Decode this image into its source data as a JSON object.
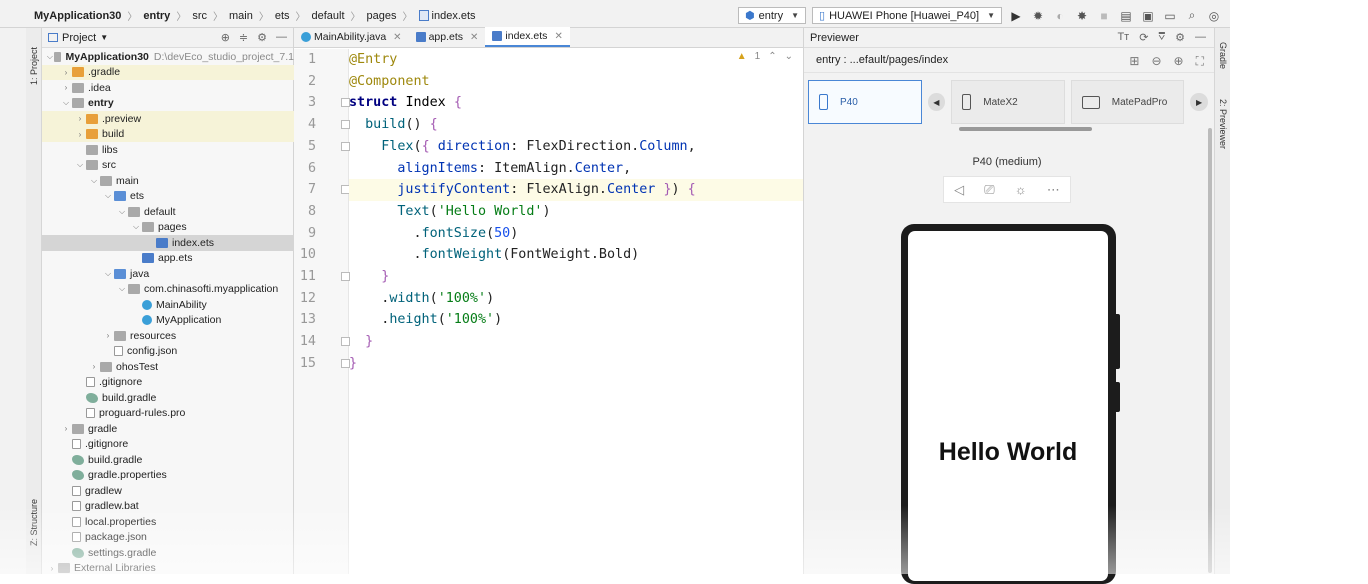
{
  "breadcrumb": [
    "MyApplication30",
    "entry",
    "src",
    "main",
    "ets",
    "default",
    "pages",
    "index.ets"
  ],
  "toolbar": {
    "run_config": "entry",
    "device": "HUAWEI Phone [Huawei_P40]"
  },
  "left_stripe": {
    "project_tab": "1: Project",
    "structure_tab": "Z: Structure"
  },
  "project_panel": {
    "title": "Project",
    "tree": [
      {
        "label": "MyApplication30",
        "sub": "D:\\devEco_studio_project_7.1",
        "depth": 0,
        "icon": "folder",
        "arrow": "open",
        "bold": true
      },
      {
        "label": ".gradle",
        "depth": 1,
        "icon": "folder-o",
        "arrow": "closed",
        "hl": true
      },
      {
        "label": ".idea",
        "depth": 1,
        "icon": "folder",
        "arrow": "closed"
      },
      {
        "label": "entry",
        "depth": 1,
        "icon": "folder",
        "arrow": "open",
        "bold": true
      },
      {
        "label": ".preview",
        "depth": 2,
        "icon": "folder-o",
        "arrow": "closed",
        "hl": true
      },
      {
        "label": "build",
        "depth": 2,
        "icon": "folder-o",
        "arrow": "closed",
        "hl": true
      },
      {
        "label": "libs",
        "depth": 2,
        "icon": "folder",
        "arrow": ""
      },
      {
        "label": "src",
        "depth": 2,
        "icon": "folder",
        "arrow": "open"
      },
      {
        "label": "main",
        "depth": 3,
        "icon": "folder",
        "arrow": "open"
      },
      {
        "label": "ets",
        "depth": 4,
        "icon": "folder-b",
        "arrow": "open"
      },
      {
        "label": "default",
        "depth": 5,
        "icon": "folder",
        "arrow": "open"
      },
      {
        "label": "pages",
        "depth": 6,
        "icon": "folder",
        "arrow": "open"
      },
      {
        "label": "index.ets",
        "depth": 7,
        "icon": "ets",
        "arrow": "",
        "sel": true
      },
      {
        "label": "app.ets",
        "depth": 6,
        "icon": "ets",
        "arrow": ""
      },
      {
        "label": "java",
        "depth": 4,
        "icon": "folder-b",
        "arrow": "open"
      },
      {
        "label": "com.chinasofti.myapplication",
        "depth": 5,
        "icon": "folder",
        "arrow": "open"
      },
      {
        "label": "MainAbility",
        "depth": 6,
        "icon": "class",
        "arrow": ""
      },
      {
        "label": "MyApplication",
        "depth": 6,
        "icon": "class",
        "arrow": ""
      },
      {
        "label": "resources",
        "depth": 4,
        "icon": "folder",
        "arrow": "closed"
      },
      {
        "label": "config.json",
        "depth": 4,
        "icon": "file",
        "arrow": ""
      },
      {
        "label": "ohosTest",
        "depth": 3,
        "icon": "folder",
        "arrow": "closed"
      },
      {
        "label": ".gitignore",
        "depth": 2,
        "icon": "file",
        "arrow": ""
      },
      {
        "label": "build.gradle",
        "depth": 2,
        "icon": "gradle",
        "arrow": ""
      },
      {
        "label": "proguard-rules.pro",
        "depth": 2,
        "icon": "file",
        "arrow": ""
      },
      {
        "label": "gradle",
        "depth": 1,
        "icon": "folder",
        "arrow": "closed"
      },
      {
        "label": ".gitignore",
        "depth": 1,
        "icon": "file",
        "arrow": ""
      },
      {
        "label": "build.gradle",
        "depth": 1,
        "icon": "gradle",
        "arrow": ""
      },
      {
        "label": "gradle.properties",
        "depth": 1,
        "icon": "gradle",
        "arrow": ""
      },
      {
        "label": "gradlew",
        "depth": 1,
        "icon": "file",
        "arrow": ""
      },
      {
        "label": "gradlew.bat",
        "depth": 1,
        "icon": "file",
        "arrow": ""
      },
      {
        "label": "local.properties",
        "depth": 1,
        "icon": "file",
        "arrow": ""
      },
      {
        "label": "package.json",
        "depth": 1,
        "icon": "file",
        "arrow": ""
      },
      {
        "label": "settings.gradle",
        "depth": 1,
        "icon": "gradle",
        "arrow": ""
      },
      {
        "label": "External Libraries",
        "depth": 0,
        "icon": "folder",
        "arrow": "closed"
      }
    ]
  },
  "editor": {
    "tabs": [
      {
        "label": "MainAbility.java",
        "icon": "class",
        "active": false
      },
      {
        "label": "app.ets",
        "icon": "ets",
        "active": false
      },
      {
        "label": "index.ets",
        "icon": "ets",
        "active": true
      }
    ],
    "warning_count": "1",
    "lines": [
      [
        [
          "an",
          "@Entry"
        ]
      ],
      [
        [
          "an",
          "@Component"
        ]
      ],
      [
        [
          "kw",
          "struct "
        ],
        [
          "ty",
          "Index "
        ],
        [
          "pu",
          "{"
        ]
      ],
      [
        [
          "pl",
          "  "
        ],
        [
          "fn",
          "build"
        ],
        [
          "pl",
          "() "
        ],
        [
          "pu",
          "{"
        ]
      ],
      [
        [
          "pl",
          "    "
        ],
        [
          "fn",
          "Flex"
        ],
        [
          "pl",
          "("
        ],
        [
          "pu",
          "{ "
        ],
        [
          "k",
          "direction"
        ],
        [
          "pl",
          ": FlexDirection."
        ],
        [
          "k",
          "Column"
        ],
        [
          "pl",
          ","
        ]
      ],
      [
        [
          "pl",
          "      "
        ],
        [
          "k",
          "alignItems"
        ],
        [
          "pl",
          ": ItemAlign."
        ],
        [
          "k",
          "Center"
        ],
        [
          "pl",
          ","
        ]
      ],
      [
        [
          "pl",
          "      "
        ],
        [
          "k",
          "justifyContent"
        ],
        [
          "pl",
          ": FlexAlign."
        ],
        [
          "k",
          "Center "
        ],
        [
          "pu",
          "}"
        ],
        [
          "pl",
          ") "
        ],
        [
          "pu",
          "{"
        ]
      ],
      [
        [
          "pl",
          "      "
        ],
        [
          "fn",
          "Text"
        ],
        [
          "pl",
          "("
        ],
        [
          "str",
          "'Hello World'"
        ],
        [
          "pl",
          ")"
        ]
      ],
      [
        [
          "pl",
          "        ."
        ],
        [
          "fn",
          "fontSize"
        ],
        [
          "pl",
          "("
        ],
        [
          "num",
          "50"
        ],
        [
          "pl",
          ")"
        ]
      ],
      [
        [
          "pl",
          "        ."
        ],
        [
          "fn",
          "fontWeight"
        ],
        [
          "pl",
          "(FontWeight.Bold)"
        ]
      ],
      [
        [
          "pl",
          "    "
        ],
        [
          "pu",
          "}"
        ]
      ],
      [
        [
          "pl",
          "    ."
        ],
        [
          "fn",
          "width"
        ],
        [
          "pl",
          "("
        ],
        [
          "str",
          "'100%'"
        ],
        [
          "pl",
          ")"
        ]
      ],
      [
        [
          "pl",
          "    ."
        ],
        [
          "fn",
          "height"
        ],
        [
          "pl",
          "("
        ],
        [
          "str",
          "'100%'"
        ],
        [
          "pl",
          ")"
        ]
      ],
      [
        [
          "pl",
          "  "
        ],
        [
          "pu",
          "}"
        ]
      ],
      [
        [
          "pu",
          "}"
        ]
      ]
    ],
    "current_line": 7
  },
  "previewer": {
    "title": "Previewer",
    "path": "entry : ...efault/pages/index",
    "devices": [
      {
        "label": "P40",
        "active": true,
        "icon": "phone"
      },
      {
        "label": "MateX2",
        "active": false,
        "icon": "phone"
      },
      {
        "label": "MatePadPro",
        "active": false,
        "icon": "tablet"
      }
    ],
    "device_title": "P40 (medium)",
    "preview_text": "Hello World"
  },
  "right_stripe": {
    "gradle_tab": "Gradle",
    "previewer_tab": "2: Previewer"
  }
}
